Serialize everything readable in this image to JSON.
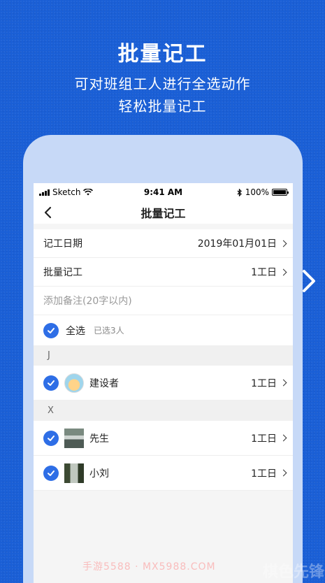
{
  "promo": {
    "title": "批量记工",
    "subtitle_line1": "可对班组工人进行全选动作",
    "subtitle_line2": "轻松批量记工"
  },
  "status_bar": {
    "carrier": "Sketch",
    "time": "9:41 AM",
    "battery": "100%"
  },
  "nav": {
    "back_icon": "chevron-left-icon",
    "title": "批量记工"
  },
  "form": {
    "date_label": "记工日期",
    "date_value": "2019年01月01日",
    "batch_label": "批量记工",
    "batch_value": "1工日",
    "remark_placeholder": "添加备注(20字以内)"
  },
  "select_all": {
    "label": "全选",
    "count": "已选3人",
    "checked": true
  },
  "groups": [
    {
      "header": "J",
      "members": [
        {
          "name": "建设者",
          "value": "1工日",
          "checked": true,
          "avatar": "cartoon-avatar"
        }
      ]
    },
    {
      "header": "X",
      "members": [
        {
          "name": "先生",
          "value": "1工日",
          "checked": true,
          "avatar": "photo-avatar"
        },
        {
          "name": "小刘",
          "value": "1工日",
          "checked": true,
          "avatar": "photo-avatar"
        }
      ]
    }
  ],
  "side_nav": {
    "icon": "chevron-right-icon"
  },
  "watermark": {
    "text": "手游5588 · MX5988.COM",
    "logo": "棋色先锋"
  },
  "colors": {
    "background": "#1a5fd6",
    "accent": "#2e6ee6",
    "device": "#c7d9f7"
  }
}
